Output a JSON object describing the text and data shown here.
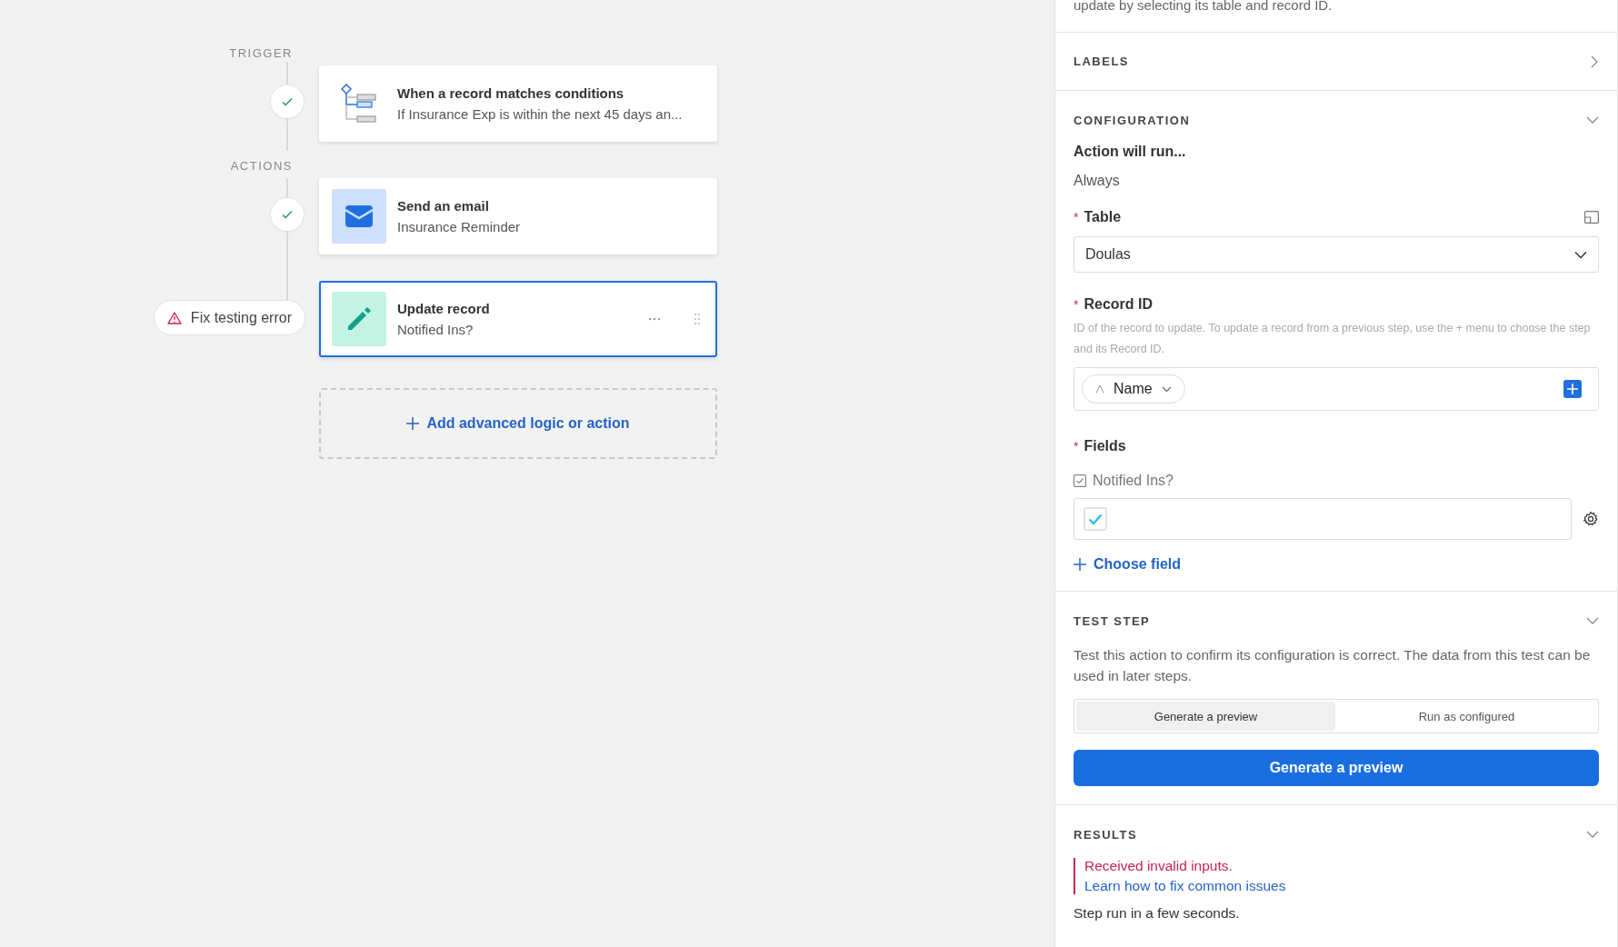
{
  "canvas": {
    "sections": [
      {
        "label": "TRIGGER",
        "steps": [
          {
            "kind": "conditions",
            "title": "When a record matches conditions",
            "subtitle": "If Insurance Exp is within the next 45 days an...",
            "error": false,
            "selected": false
          }
        ]
      },
      {
        "label": "ACTIONS",
        "steps": [
          {
            "kind": "email",
            "title": "Send an email",
            "subtitle": "Insurance Reminder",
            "error": false,
            "selected": false
          },
          {
            "kind": "update",
            "title": "Update record",
            "subtitle": "Notified Ins?",
            "error": true,
            "error_text": "Fix testing error",
            "selected": true
          }
        ]
      }
    ],
    "add_button": "Add advanced logic or action"
  },
  "panel": {
    "intro": "update by selecting its table and record ID.",
    "labels": {
      "title": "LABELS",
      "expanded": false
    },
    "configuration": {
      "title": "CONFIGURATION",
      "expanded": true,
      "run_label": "Action will run...",
      "run_value": "Always",
      "table": {
        "label": "Table",
        "required_mark": "*",
        "value": "Doulas"
      },
      "record_id": {
        "label": "Record ID",
        "required_mark": "*",
        "hint": "ID of the record to update. To update a record from a previous step, use the + menu to choose the step and its Record ID.",
        "token": "Name"
      },
      "fields": {
        "label": "Fields",
        "required_mark": "*",
        "items": [
          {
            "name": "Notified Ins?",
            "checked": true
          }
        ],
        "choose": "Choose field"
      }
    },
    "test_step": {
      "title": "TEST STEP",
      "expanded": true,
      "description": "Test this action to confirm its configuration is correct. The data from this test can be used in later steps.",
      "modes": [
        {
          "label": "Generate a preview",
          "selected": true
        },
        {
          "label": "Run as configured",
          "selected": false
        }
      ],
      "button": "Generate a preview"
    },
    "results": {
      "title": "RESULTS",
      "expanded": true,
      "error": "Received invalid inputs.",
      "link": "Learn how to fix common issues",
      "note": "Step run in a few seconds."
    }
  }
}
